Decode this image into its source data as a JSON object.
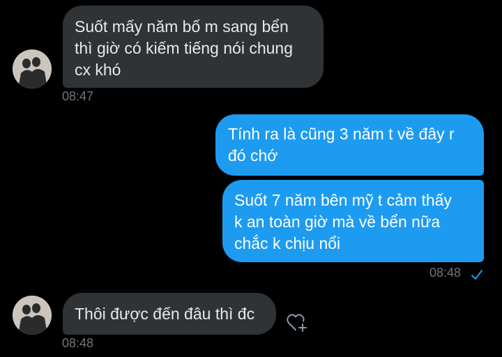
{
  "colors": {
    "background": "#000000",
    "received_bubble": "#2f3336",
    "sent_bubble": "#1d9bf0",
    "timestamp": "#71767b",
    "seen_check": "#1d9bf0"
  },
  "messages": [
    {
      "direction": "received",
      "lines": [
        "Suốt mấy năm bố m sang bển",
        "thì giờ có kiếm tiếng nói chung",
        "cx khó"
      ],
      "time": "08:47",
      "avatar_icon": "user-avatar-photo"
    },
    {
      "direction": "sent",
      "lines": [
        "Tính ra là cũng 3 năm t về đây r",
        "đó chớ"
      ]
    },
    {
      "direction": "sent",
      "lines": [
        "Suốt 7 năm bên mỹ t cảm thấy",
        "k an toàn giờ mà về bển nữa",
        "chắc k chịu nổi"
      ],
      "time": "08:48",
      "status_icon": "seen-check-icon"
    },
    {
      "direction": "received",
      "lines": [
        "Thôi được đến đâu thì đc"
      ],
      "time": "08:48",
      "avatar_icon": "user-avatar-photo",
      "action_icon": "add-reaction-heart-icon"
    }
  ]
}
